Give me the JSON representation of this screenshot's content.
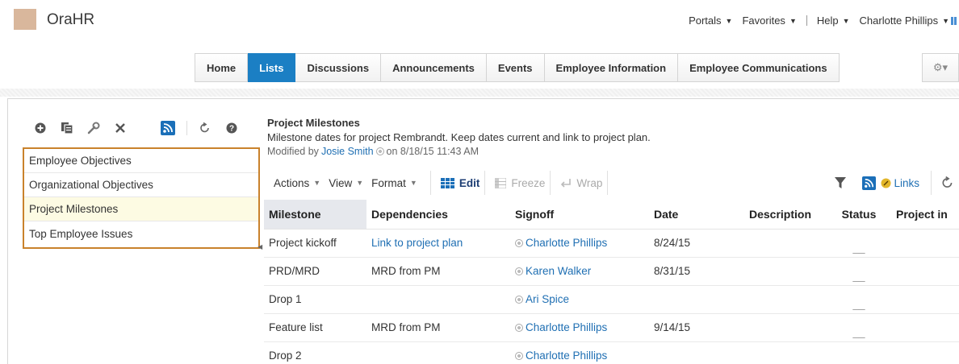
{
  "app": {
    "title": "OraHR",
    "logo_color": "#d9b79c"
  },
  "top_menu": {
    "portals": "Portals",
    "favorites": "Favorites",
    "help": "Help",
    "user": "Charlotte Phillips"
  },
  "tabs": [
    {
      "label": "Home",
      "active": false
    },
    {
      "label": "Lists",
      "active": true
    },
    {
      "label": "Discussions",
      "active": false
    },
    {
      "label": "Announcements",
      "active": false
    },
    {
      "label": "Events",
      "active": false
    },
    {
      "label": "Employee Information",
      "active": false
    },
    {
      "label": "Employee Communications",
      "active": false
    }
  ],
  "colors": {
    "accent": "#1b7fc4",
    "selection_border": "#c9822c",
    "link": "#1f6fb3"
  },
  "left_panel": {
    "toolbar_icons": [
      "add-icon",
      "copy-icon",
      "wrench-icon",
      "delete-icon",
      "rss-icon",
      "refresh-icon",
      "help-icon"
    ],
    "lists": [
      {
        "label": "Employee Objectives",
        "selected": false
      },
      {
        "label": "Organizational Objectives",
        "selected": false
      },
      {
        "label": "Project Milestones",
        "selected": true
      },
      {
        "label": "Top Employee Issues",
        "selected": false
      }
    ]
  },
  "list_detail": {
    "title": "Project Milestones",
    "description": "Milestone dates for project Rembrandt. Keep dates current and link to project plan.",
    "modified_prefix": "Modified by",
    "modified_by": "Josie Smith",
    "modified_on": "on 8/18/15 11:43 AM"
  },
  "toolbar": {
    "actions": "Actions",
    "view": "View",
    "format": "Format",
    "edit": "Edit",
    "freeze": "Freeze",
    "wrap": "Wrap",
    "links": "Links"
  },
  "table": {
    "columns": [
      "Milestone",
      "Dependencies",
      "Signoff",
      "Date",
      "Description",
      "Status",
      "Project in"
    ],
    "rows": [
      {
        "milestone": "Project kickoff",
        "dependencies": "Link to project plan",
        "dependency_is_link": true,
        "signoff": "Charlotte Phillips",
        "date": "8/24/15",
        "description": "",
        "status": "__"
      },
      {
        "milestone": "PRD/MRD",
        "dependencies": "MRD from PM",
        "dependency_is_link": false,
        "signoff": "Karen Walker",
        "date": "8/31/15",
        "description": "",
        "status": "__"
      },
      {
        "milestone": "Drop 1",
        "dependencies": "",
        "dependency_is_link": false,
        "signoff": "Ari Spice",
        "date": "",
        "description": "",
        "status": "__"
      },
      {
        "milestone": "Feature list",
        "dependencies": "MRD from PM",
        "dependency_is_link": false,
        "signoff": "Charlotte Phillips",
        "date": "9/14/15",
        "description": "",
        "status": "__"
      },
      {
        "milestone": "Drop 2",
        "dependencies": "",
        "dependency_is_link": false,
        "signoff": "Charlotte Phillips",
        "date": "",
        "description": "",
        "status": "__"
      }
    ]
  }
}
